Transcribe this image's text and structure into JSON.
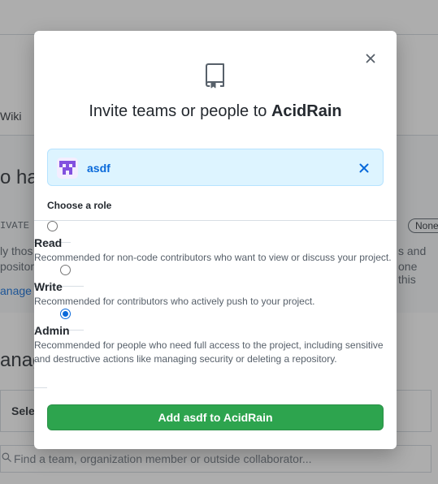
{
  "background": {
    "tab_wiki": "Wiki",
    "heading_fragment": "o ha",
    "private_fragment": "IVATE",
    "line1_fragment": "ly thos",
    "line2_fragment": "positor",
    "manage_link_fragment": "anage",
    "none_pill": "None",
    "right1_fragment": "s and",
    "right2_fragment": "one this",
    "manage_heading_fragment": "anag",
    "select_fragment": "Sele",
    "search_placeholder": "Find a team, organization member or outside collaborator..."
  },
  "modal": {
    "title_prefix": "Invite teams or people to ",
    "repo_name": "AcidRain",
    "selected_user": "asdf",
    "choose_role_label": "Choose a role",
    "roles": [
      {
        "label": "Read",
        "description": "Recommended for non-code contributors who want to view or discuss your project.",
        "selected": false
      },
      {
        "label": "Write",
        "description": "Recommended for contributors who actively push to your project.",
        "selected": false
      },
      {
        "label": "Admin",
        "description": "Recommended for people who need full access to the project, including sensitive and destructive actions like managing security or deleting a repository.",
        "selected": true
      }
    ],
    "submit_label": "Add asdf to AcidRain"
  },
  "colors": {
    "primary_button": "#2da44e",
    "link_blue": "#0969da",
    "chip_background": "#ddf4ff",
    "avatar_purple": "#8250df"
  },
  "icons": {
    "close": "x-icon",
    "repo": "repo-icon",
    "chip_remove": "x-icon",
    "search": "search-icon"
  }
}
